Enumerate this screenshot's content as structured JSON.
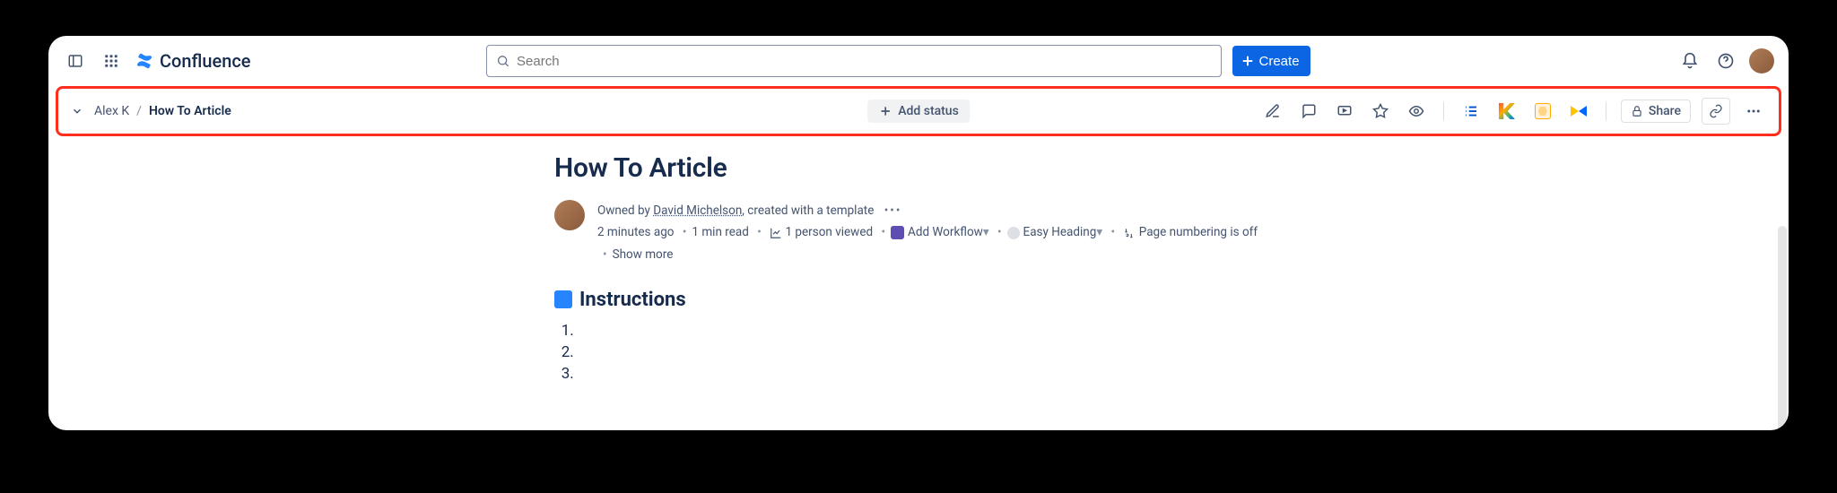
{
  "header": {
    "product": "Confluence",
    "search_placeholder": "Search",
    "create_label": "Create"
  },
  "breadcrumb": {
    "space": "Alex K",
    "page": "How To Article"
  },
  "pagebar": {
    "add_status": "Add status",
    "share": "Share"
  },
  "page": {
    "title": "How To Article",
    "owned_prefix": "Owned by ",
    "owner": "David Michelson",
    "owned_suffix": ", created with a template",
    "age": "2 minutes ago",
    "read_time": "1 min read",
    "viewers": "1 person viewed",
    "add_workflow": "Add Workflow",
    "easy_heading": "Easy Heading",
    "page_numbering": "Page numbering is off",
    "show_more": "Show more"
  },
  "section": {
    "instructions": "Instructions",
    "items": [
      "",
      "",
      ""
    ]
  }
}
